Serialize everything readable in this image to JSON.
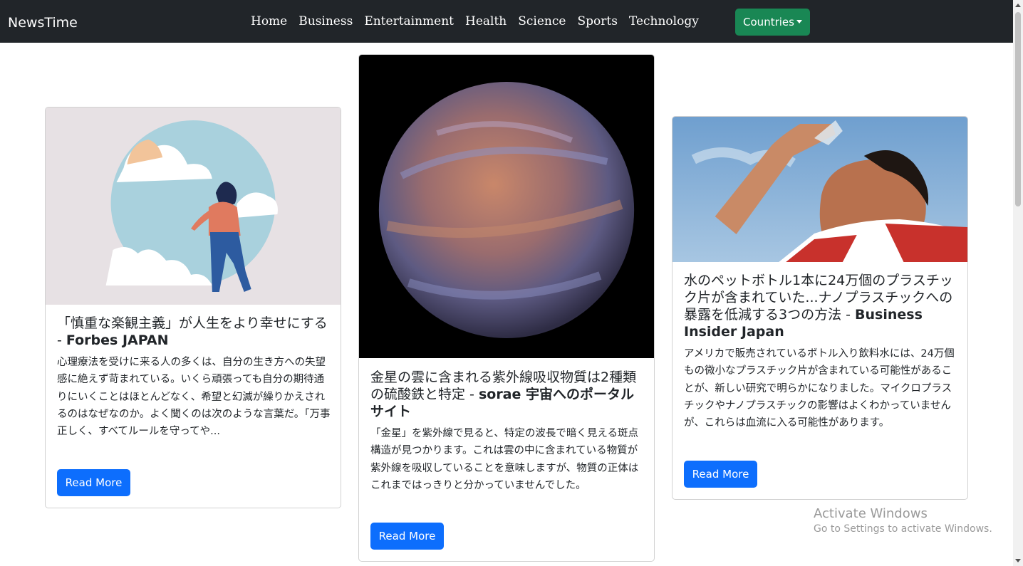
{
  "navbar": {
    "brand": "NewsTime",
    "links": [
      "Home",
      "Business",
      "Entertainment",
      "Health",
      "Science",
      "Sports",
      "Technology"
    ],
    "countries_label": "Countries"
  },
  "cards": [
    {
      "image": "illustration-woman-in-circle",
      "title": "「慎重な楽観主義」が人生をより幸せにする",
      "source": "Forbes JAPAN",
      "description": "心理療法を受けに来る人の多くは、自分の生き方への失望感に絶えず苛まれている。いくら頑張っても自分の期待通りにいくことはほとんどなく、希望と幻滅が繰りかえされるのはなぜなのか。よく聞くのは次のような言葉だ。「万事正しく、すべてルールを守ってや...",
      "button": "Read More"
    },
    {
      "image": "planet-venus",
      "title": "金星の雲に含まれる紫外線吸収物質は2種類の硫酸鉄と特定",
      "source": "sorae 宇宙へのポータルサイト",
      "description": "「金星」を紫外線で見ると、特定の波長で暗く見える斑点構造が見つかります。これは雲の中に含まれている物質が紫外線を吸収していることを意味しますが、物質の正体はこれまではっきりと分かっていませんでした。",
      "button": "Read More"
    },
    {
      "image": "man-drinking-water-bottle",
      "title": "水のペットボトル1本に24万個のプラスチック片が含まれていた...ナノプラスチックへの暴露を低減する3つの方法",
      "source": "Business Insider Japan",
      "description": "アメリカで販売されているボトル入り飲料水には、24万個もの微小なプラスチック片が含まれている可能性があることが、新しい研究で明らかになりました。マイクロプラスチックやナノプラスチックの影響はよくわかっていませんが、これらは血流に入る可能性があります。",
      "button": "Read More"
    }
  ],
  "watermark": {
    "line1": "Activate Windows",
    "line2": "Go to Settings to activate Windows."
  },
  "colors": {
    "navbar": "#212529",
    "countries_button": "#198754",
    "read_more_button": "#0d6efd"
  }
}
